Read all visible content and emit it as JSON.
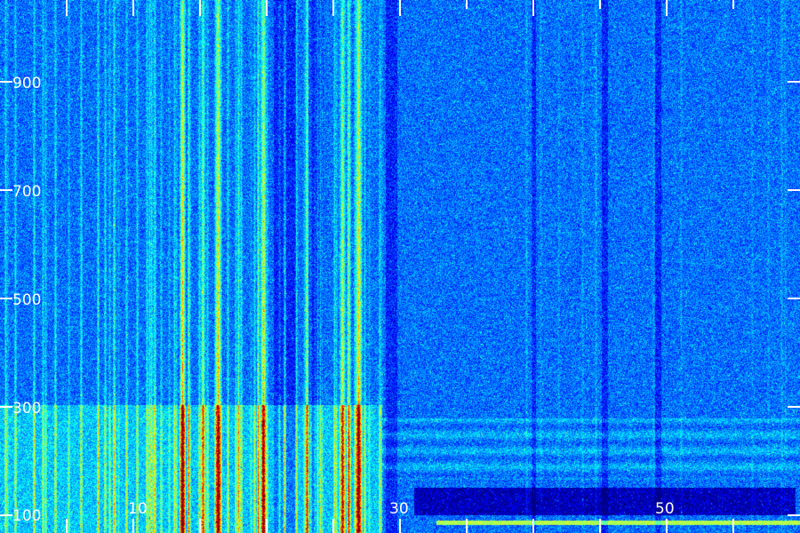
{
  "image": {
    "kind": "spectrogram",
    "colormap": "jet",
    "background_color": "#101a6e",
    "axis_color": "#ffffff"
  },
  "y_axis": {
    "tick_labels": [
      "900",
      "700",
      "500",
      "300",
      "100"
    ],
    "ticks": [
      900,
      700,
      500,
      300,
      100
    ]
  },
  "x_axis": {
    "tick_labels": [
      "10",
      "30",
      "50"
    ],
    "ticks": [
      10,
      30,
      50
    ]
  }
}
